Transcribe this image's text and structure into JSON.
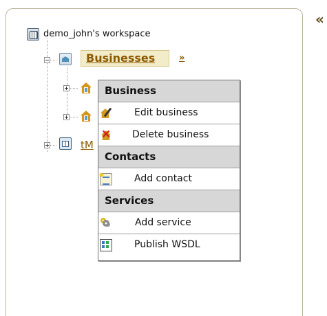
{
  "workspace": {
    "label": "demo_john's workspace"
  },
  "tree": {
    "businesses_label": "Businesses",
    "businesses_action": "»",
    "partial_node_label": "tM"
  },
  "panel": {
    "collapse_symbol": "«"
  },
  "context_menu": {
    "sections": [
      {
        "title": "Business",
        "items": [
          "Edit business",
          "Delete business"
        ]
      },
      {
        "title": "Contacts",
        "items": [
          "Add contact"
        ]
      },
      {
        "title": "Services",
        "items": [
          "Add service",
          "Publish WSDL"
        ]
      }
    ]
  },
  "icons": {
    "workspace": "workspace-icon",
    "businesses": "business-folder-icon",
    "business_node": "business-house-icon",
    "tmodel": "tmodel-icon",
    "edit": "edit-business-icon",
    "delete": "delete-business-icon",
    "contact": "add-contact-icon",
    "service": "add-service-icon",
    "publish": "publish-wsdl-icon"
  },
  "colors": {
    "link_brown": "#8c5a00",
    "selected_background": "#f3ecc9",
    "menu_header": "#d7d7d7",
    "delete_red": "#df1515"
  }
}
